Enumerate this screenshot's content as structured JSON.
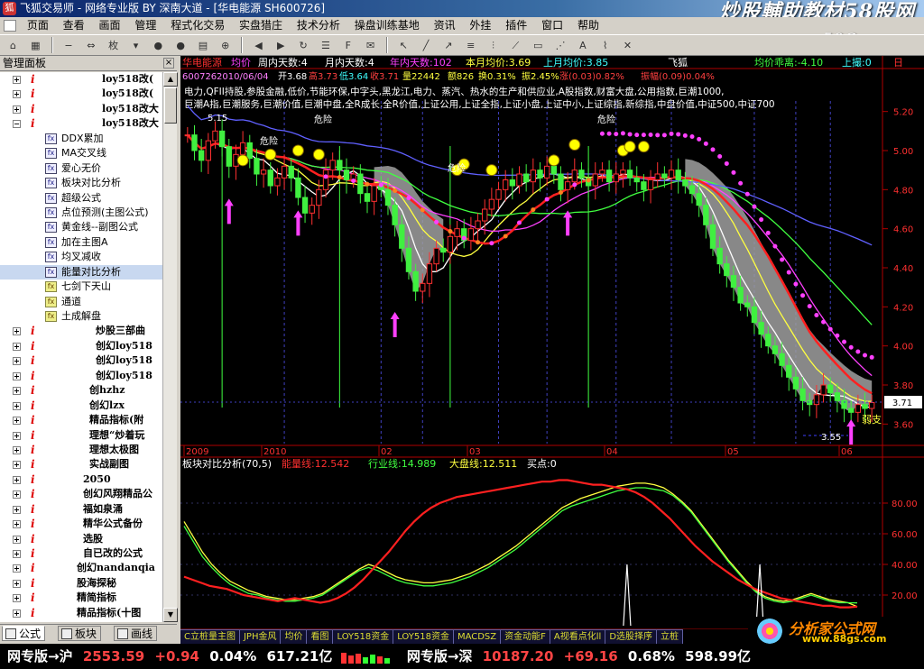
{
  "window": {
    "title": "飞狐交易师 - 网络专业版 BY 深南大道 - [华电能源 SH600726]"
  },
  "watermark": {
    "line1": "炒股輔助教材58股网",
    "line2": "www.58Gu.com"
  },
  "menu": [
    "页面",
    "查看",
    "画面",
    "管理",
    "程式化交易",
    "实盘猎庄",
    "技术分析",
    "操盘训练基地",
    "资讯",
    "外挂",
    "插件",
    "窗口",
    "帮助"
  ],
  "toolbar": {
    "period_label": "枚"
  },
  "panel": {
    "title": "管理面板",
    "close": "×"
  },
  "tree": [
    {
      "type": "i",
      "indent": 1,
      "label": "loy518改(",
      "bold": true
    },
    {
      "type": "i",
      "indent": 1,
      "label": "loy518改(",
      "bold": true
    },
    {
      "type": "i",
      "indent": 1,
      "label": "loy518改大",
      "bold": true
    },
    {
      "type": "i",
      "indent": 1,
      "label": "loy518改大",
      "bold": true,
      "open": true
    },
    {
      "type": "fx",
      "label": "DDX累加"
    },
    {
      "type": "fx",
      "label": "MA交叉线"
    },
    {
      "type": "fx",
      "label": "爱心无价"
    },
    {
      "type": "fx",
      "label": "板块对比分析"
    },
    {
      "type": "fx",
      "label": "超级公式"
    },
    {
      "type": "fx",
      "label": "点位预测(主图公式)"
    },
    {
      "type": "fx",
      "label": "黄金线--副图公式"
    },
    {
      "type": "fx",
      "label": "加在主图A"
    },
    {
      "type": "fx",
      "label": "均叉减收"
    },
    {
      "type": "fx",
      "label": "能量对比分析",
      "selected": true
    },
    {
      "type": "fx",
      "yellow": true,
      "label": "七剑下天山"
    },
    {
      "type": "fx",
      "yellow": true,
      "label": "通道"
    },
    {
      "type": "fx",
      "yellow": true,
      "label": "土成解盘"
    },
    {
      "type": "i",
      "indent": 0,
      "label": "炒股三部曲",
      "bold": true
    },
    {
      "type": "i",
      "indent": 0,
      "label": "创幻loy518",
      "bold": true
    },
    {
      "type": "i",
      "indent": 0,
      "label": "创幻loy518",
      "bold": true
    },
    {
      "type": "i",
      "indent": 0,
      "label": "创幻loy518",
      "bold": true
    },
    {
      "type": "i",
      "indent": -1,
      "label": "创hzhz",
      "bold": true
    },
    {
      "type": "i",
      "indent": -1,
      "label": "创幻lzx",
      "bold": true
    },
    {
      "type": "i",
      "indent": -1,
      "label": "精品指标(附",
      "bold": true
    },
    {
      "type": "i",
      "indent": -1,
      "label": "理想“炒着玩",
      "bold": true
    },
    {
      "type": "i",
      "indent": -1,
      "label": "理想太极图",
      "bold": true
    },
    {
      "type": "i",
      "indent": -1,
      "label": "实战副图",
      "bold": true
    },
    {
      "type": "i",
      "indent": -2,
      "label": "2050",
      "bold": true
    },
    {
      "type": "i",
      "indent": -2,
      "label": "创幻风翔精品公",
      "bold": true
    },
    {
      "type": "i",
      "indent": -2,
      "label": "福如泉涌",
      "bold": true
    },
    {
      "type": "i",
      "indent": -2,
      "label": "精华公式备份",
      "bold": true
    },
    {
      "type": "i",
      "indent": -2,
      "label": "选股",
      "bold": true
    },
    {
      "type": "i",
      "indent": -2,
      "label": "自已改的公式",
      "bold": true
    },
    {
      "type": "i",
      "indent": -3,
      "label": "创幻nandanqia",
      "bold": true
    },
    {
      "type": "i",
      "indent": -3,
      "label": "股海探秘",
      "bold": true
    },
    {
      "type": "i",
      "indent": -3,
      "label": "精简指标",
      "bold": true
    },
    {
      "type": "i",
      "indent": -3,
      "label": "精品指标(十图",
      "bold": true
    }
  ],
  "bottom_tabs": [
    "公式",
    "板块",
    "画线"
  ],
  "main_header": {
    "name": "华电能源",
    "mode": "均价",
    "week_days": "周内天数:4",
    "month_days": "月内天数:4",
    "year_days": "年内天数:102",
    "month_avg": "本月均价:3.69",
    "prev_month_avg": "上月均价:3.85",
    "feihu": "飞狐",
    "deviation": "均价乖离:-4.10",
    "up_move": "上撮:0",
    "period": "日"
  },
  "main_info": {
    "code": "600726",
    "date": "2010/06/04",
    "open": "开3.68",
    "high": "高3.73",
    "low": "低3.64",
    "close": "收3.71",
    "vol": "量22442",
    "amount": "额826",
    "turnover": "换0.31%",
    "amplitude": "振2.45%",
    "change": "涨(0.03)0.82%",
    "ratio": "振幅(0.09)0.04%"
  },
  "concept_line1": "电力,QFII持股,参股金融,低价,节能环保,中字头,黑龙江,电力、蒸汽、热水的生产和供应业,A股指数,财富大盘,公用指数,巨潮1000,",
  "concept_line2": "巨潮A指,巨潮服务,巨潮价值,巨潮中盘,全R成长,全R价值,上证公用,上证全指,上证小盘,上证中小,上证综指,新综指,中盘价值,中证500,中证700",
  "price_axis": [
    "5.20",
    "5.00",
    "4.80",
    "4.60",
    "4.40",
    "4.20",
    "4.00",
    "3.80",
    "3.60"
  ],
  "price_marks": {
    "current": "3.71",
    "high_label": "5.15",
    "low_label": "3.55",
    "support": "弱支"
  },
  "date_axis": [
    "2009",
    "2010",
    "02",
    "03",
    "04",
    "05",
    "06"
  ],
  "danger_labels": [
    "危险",
    "危险",
    "危险",
    "危险"
  ],
  "sub_header": {
    "name": "板块对比分析(70,5)",
    "energy": "能量线:12.542",
    "industry": "行业线:14.989",
    "market": "大盘线:12.511",
    "buy": "买点:0"
  },
  "sub_axis": [
    "80.00",
    "60.00",
    "40.00",
    "20.00"
  ],
  "sub_tabs": [
    "C立桩量主图",
    "JPH金风",
    "均价",
    "看图",
    "LOY518资金",
    "LOY518资金",
    "MACDSZ",
    "资金动能F",
    "A视看点化ll",
    "D选股择序",
    "立桩"
  ],
  "status": {
    "sh_label": "网专版→沪",
    "sh_index": "2553.59",
    "sh_change": "+0.94",
    "sh_pct": "0.04%",
    "sh_amount": "617.21亿",
    "sz_label": "网专版→深",
    "sz_index": "10187.20",
    "sz_change": "+69.16",
    "sz_pct": "0.68%",
    "sz_amount": "598.99亿"
  },
  "logo_br": {
    "line1": "分析家公式网",
    "line2": "www.88gs.com"
  },
  "colors": {
    "up": "#ff3030",
    "down": "#20e0e0",
    "green_candle": "#40f040",
    "purple": "#ff40ff",
    "gray_fill": "#a0a0a0"
  },
  "chart_data": {
    "type": "candlestick",
    "price_range": [
      3.5,
      5.3
    ],
    "sub_range": [
      0,
      100
    ],
    "closes": [
      5.08,
      5.0,
      4.95,
      5.05,
      5.1,
      5.02,
      4.92,
      4.98,
      5.04,
      4.96,
      4.88,
      4.9,
      4.82,
      4.86,
      4.92,
      4.86,
      4.76,
      4.68,
      4.72,
      4.8,
      4.9,
      4.95,
      4.9,
      4.85,
      4.88,
      4.78,
      4.74,
      4.82,
      4.8,
      4.72,
      4.62,
      4.5,
      4.38,
      4.28,
      4.32,
      4.42,
      4.5,
      4.48,
      4.56,
      4.6,
      4.54,
      4.6,
      4.64,
      4.7,
      4.75,
      4.8,
      4.85,
      4.82,
      4.88,
      4.84,
      4.9,
      4.86,
      4.92,
      4.88,
      4.8,
      4.84,
      4.9,
      4.86,
      4.82,
      4.88,
      4.9,
      4.84,
      4.88,
      4.9,
      4.86,
      4.84,
      4.8,
      4.85,
      4.88,
      4.86,
      4.9,
      4.85,
      4.82,
      4.78,
      4.72,
      4.62,
      4.5,
      4.42,
      4.36,
      4.3,
      4.22,
      4.2,
      4.12,
      4.06,
      4.0,
      3.96,
      3.9,
      3.84,
      3.78,
      3.72,
      3.7,
      3.75,
      3.8,
      3.76,
      3.72,
      3.68,
      3.66,
      3.7,
      3.68,
      3.71
    ],
    "sub_energy": [
      32,
      30,
      28,
      26,
      25,
      24,
      22,
      20,
      19,
      18,
      17,
      16,
      17,
      18,
      17,
      16,
      15,
      16,
      18,
      21,
      25,
      30,
      36,
      42,
      48,
      55,
      62,
      68,
      73,
      77,
      80,
      82,
      84,
      85,
      86,
      87,
      88,
      89,
      90,
      91,
      92,
      93,
      94,
      94,
      95,
      95,
      94,
      93,
      92,
      92,
      91,
      90,
      89,
      87,
      84,
      80,
      75,
      70,
      64,
      58,
      52,
      47,
      42,
      38,
      34,
      30,
      27,
      24,
      22,
      20,
      18,
      17,
      16,
      15,
      14,
      13,
      13,
      12,
      12,
      12.5
    ],
    "sub_industry": [
      65,
      55,
      45,
      38,
      32,
      27,
      24,
      21,
      20,
      18,
      17,
      16,
      16,
      17,
      18,
      20,
      24,
      28,
      32,
      36,
      38,
      36,
      33,
      30,
      28,
      27,
      26,
      26,
      27,
      28,
      30,
      32,
      35,
      38,
      42,
      46,
      50,
      55,
      60,
      65,
      70,
      75,
      78,
      80,
      82,
      84,
      86,
      88,
      89,
      90,
      90,
      89,
      88,
      85,
      80,
      74,
      66,
      58,
      50,
      42,
      35,
      28,
      22,
      18,
      16,
      15,
      16,
      18,
      20,
      18,
      16,
      15,
      15,
      14.9
    ],
    "sub_market": [
      68,
      58,
      48,
      40,
      34,
      29,
      26,
      23,
      21,
      19,
      18,
      17,
      17,
      18,
      19,
      21,
      25,
      29,
      33,
      37,
      40,
      38,
      35,
      32,
      30,
      29,
      28,
      28,
      29,
      30,
      32,
      34,
      37,
      40,
      44,
      48,
      52,
      57,
      62,
      67,
      72,
      77,
      80,
      83,
      85,
      87,
      89,
      91,
      92,
      93,
      93,
      92,
      90,
      86,
      81,
      75,
      67,
      59,
      51,
      43,
      36,
      29,
      23,
      19,
      17,
      16,
      17,
      19,
      21,
      19,
      17,
      16,
      15,
      12.5
    ],
    "buy_spikes": [
      48,
      63,
      82,
      85,
      87
    ]
  }
}
